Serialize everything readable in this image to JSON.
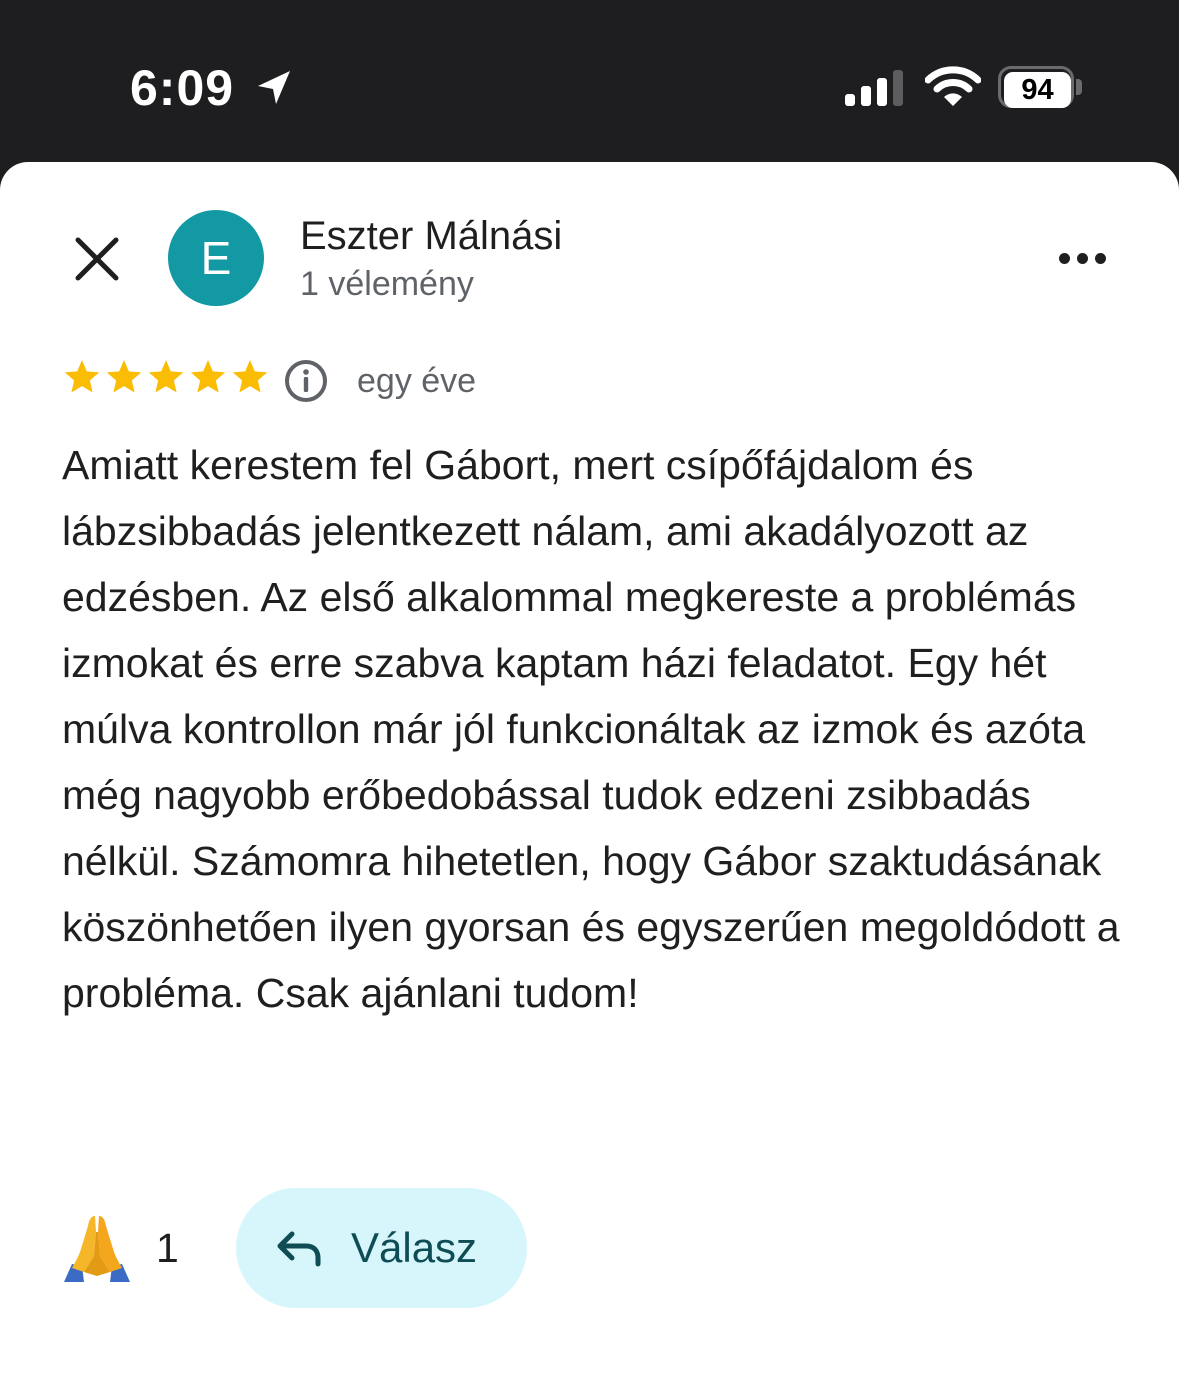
{
  "status_bar": {
    "time": "6:09",
    "battery": "94",
    "icons": [
      "location-arrow-icon",
      "cellular-signal-icon",
      "wifi-icon",
      "battery-icon"
    ]
  },
  "reviewer": {
    "avatar_initial": "E",
    "avatar_color": "#1299A4",
    "name": "Eszter Málnási",
    "review_count": "1 vélemény"
  },
  "review": {
    "rating": 5,
    "max_rating": 5,
    "star_color": "#FBBC04",
    "date": "egy éve",
    "text": "Amiatt kerestem fel Gábort, mert csípőfájdalom és lábzsibbadás jelentkezett nálam, ami akadályozott az edzésben. Az első alkalommal megkereste a problémás izmokat és erre szabva kaptam házi feladatot. Egy hét múlva kontrollon már jól funkcionáltak az izmok és azóta még nagyobb erőbedobással tudok edzeni zsibbadás nélkül. Számomra hihetetlen, hogy Gábor szaktudásának köszönhetően ilyen gyorsan és egyszerűen megoldódott a probléma. Csak ajánlani tudom!"
  },
  "reactions": {
    "emoji": "folded-hands-icon",
    "count": "1"
  },
  "actions": {
    "reply_label": "Válasz",
    "reply_bg": "#D7F6FB",
    "reply_color": "#0E4D54"
  }
}
